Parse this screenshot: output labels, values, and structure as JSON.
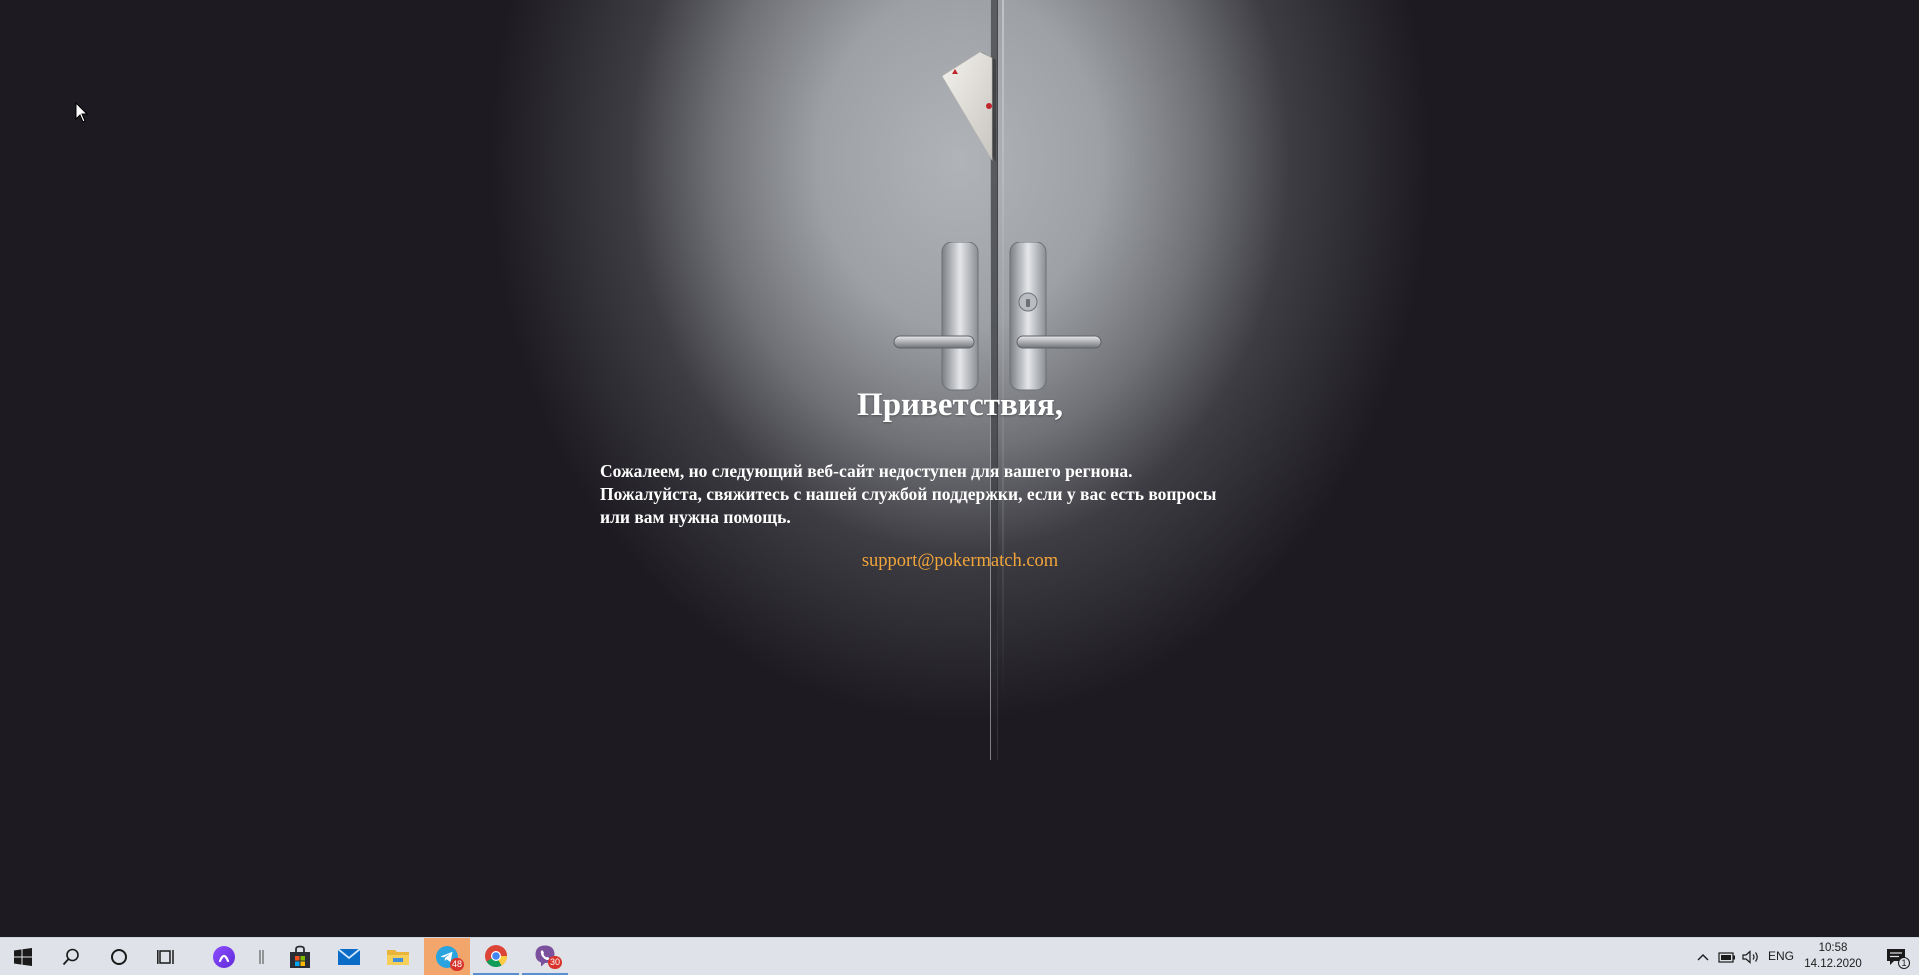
{
  "page": {
    "greeting": "Приветствия,",
    "message_lines": [
      "Сожалеем, но следующий веб-сайт недоступен для вашего регнона.",
      "Пожалуйста, свяжитесь с нашей службой поддержки, если у вас есть вопросы",
      "или вам нужна помощь."
    ],
    "support_email": "support@pokermatch.com"
  },
  "colors": {
    "background": "#1d1b21",
    "text": "#ffffff",
    "link": "#f2a53a",
    "taskbar": "#dfe3e9"
  },
  "taskbar": {
    "start_icon": "windows-logo-icon",
    "search_icon": "search-icon",
    "cortana_icon": "cortana-ring-icon",
    "task_view_icon": "task-view-icon",
    "apps": [
      {
        "name": "alice-assistant",
        "icon": "alice-icon"
      },
      {
        "name": "store",
        "icon": "store-bag-icon"
      },
      {
        "name": "mail",
        "icon": "mail-icon"
      },
      {
        "name": "file-explorer",
        "icon": "folder-icon"
      },
      {
        "name": "telegram",
        "icon": "telegram-icon",
        "badge": "48"
      },
      {
        "name": "chrome",
        "icon": "chrome-icon"
      },
      {
        "name": "viber",
        "icon": "viber-icon",
        "badge": "30"
      }
    ],
    "tray": {
      "language": "ENG",
      "time": "10:58",
      "date": "14.12.2020",
      "notification_count": "1"
    }
  }
}
